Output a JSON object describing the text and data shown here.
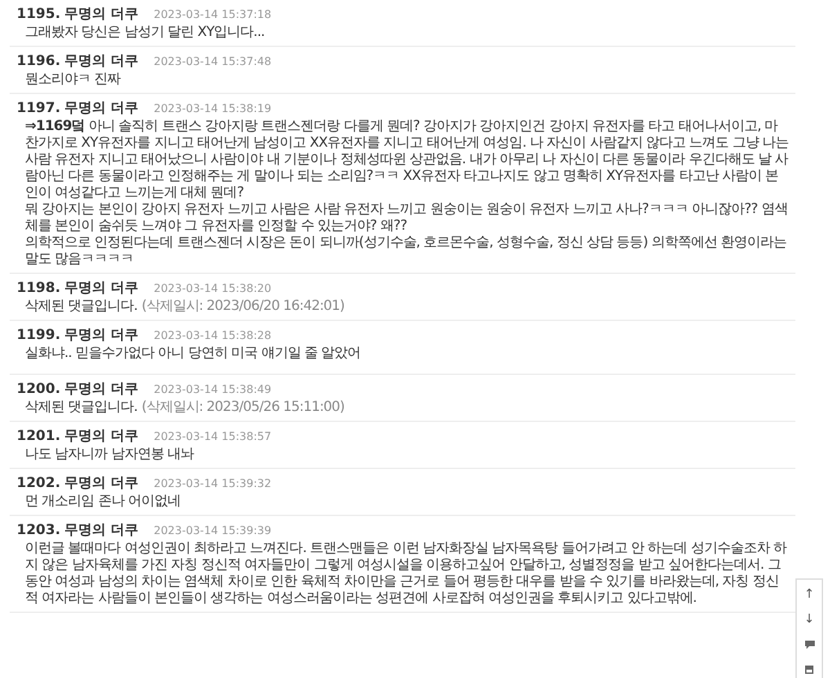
{
  "comments": [
    {
      "number": "1195.",
      "author": "무명의 더쿠",
      "time": "2023-03-14 15:37:18",
      "kind": "text",
      "body": "그래봤자 당신은 남성기 달린 XY입니다..."
    },
    {
      "number": "1196.",
      "author": "무명의 더쿠",
      "time": "2023-03-14 15:37:48",
      "kind": "text",
      "body": "뭔소리야ㅋ 진짜"
    },
    {
      "number": "1197.",
      "author": "무명의 더쿠",
      "time": "2023-03-14 15:38:19",
      "kind": "text",
      "body": "**⇒1169덬** 아니 솔직히 트랜스 강아지랑 트랜스젠더랑 다를게 뭔데? 강아지가 강아지인건 강아지 유전자를 타고 태어나서이고, 마찬가지로 XY유전자를 지니고 태어난게 남성이고 XX유전자를 지니고 태어난게 여성임. 나 자신이 사람같지 않다고 느껴도 그냥 나는 사람 유전자 지니고 태어났으니 사람이야 내 기분이나 정체성따윈 상관없음. 내가 아무리 나 자신이 다른 동물이라 우긴다해도 날 사람아닌 다른 동물이라고 인정해주는 게 말이나 되는 소리임?ㅋㅋ XX유전자 타고나지도 않고 명확히 XY유전자를 타고난 사람이 본인이 여성같다고 느끼는게 대체 뭔데?\n뭐 강아지는 본인이 강아지 유전자 느끼고 사람은 사람 유전자 느끼고 원숭이는 원숭이 유전자 느끼고 사나?ㅋㅋㅋ 아니잖아?? 염색체를 본인이 숨쉬듯 느껴야 그 유전자를 인정할 수 있는거야? 왜??\n의학적으로 인정된다는데 트랜스젠더 시장은 돈이 되니까(성기수술, 호르몬수술, 성형수술, 정신 상담 등등) 의학쪽에선 환영이라는 말도 많음ㅋㅋㅋㅋ"
    },
    {
      "number": "1198.",
      "author": "무명의 더쿠",
      "time": "2023-03-14 15:38:20",
      "kind": "deleted",
      "body": "삭제된 댓글입니다.",
      "deleted_at": "(삭제일시: 2023/06/20 16:42:01)"
    },
    {
      "number": "1199.",
      "author": "무명의 더쿠",
      "time": "2023-03-14 15:38:28",
      "kind": "text",
      "body": "실화냐.. 믿을수가없다 아니 당연히 미국 얘기일 줄 알았어"
    },
    {
      "number": "1200.",
      "author": "무명의 더쿠",
      "time": "2023-03-14 15:38:49",
      "kind": "deleted",
      "body": "삭제된 댓글입니다.",
      "deleted_at": "(삭제일시: 2023/05/26 15:11:00)"
    },
    {
      "number": "1201.",
      "author": "무명의 더쿠",
      "time": "2023-03-14 15:38:57",
      "kind": "text",
      "body": "나도 남자니까 남자연봉 내놔"
    },
    {
      "number": "1202.",
      "author": "무명의 더쿠",
      "time": "2023-03-14 15:39:32",
      "kind": "text",
      "body": "먼 개소리임 존나 어이없네"
    },
    {
      "number": "1203.",
      "author": "무명의 더쿠",
      "time": "2023-03-14 15:39:39",
      "kind": "text",
      "body": "이런글 볼때마다 여성인권이 최하라고 느껴진다. 트랜스맨들은 이런 남자화장실 남자목욕탕 들어가려고 안 하는데 성기수술조차 하지 않은 남자육체를 가진 자칭 정신적 여자들만이 그렇게 여성시설을 이용하고싶어 안달하고, 성별정정을 받고 싶어한다는데서. 그동안 여성과 남성의 차이는 염색체 차이로 인한 육체적 차이만을 근거로 들어 평등한 대우를 받을 수 있기를 바라왔는데, 자칭 정신적 여자라는 사람들이 본인들이 생각하는 여성스러움이라는 성편견에 사로잡혀 여성인권을 후퇴시키고 있다고밖에."
    }
  ],
  "float_buttons": [
    {
      "kind": "text",
      "label": "↑"
    },
    {
      "kind": "text",
      "label": "↓"
    },
    {
      "kind": "chat"
    },
    {
      "kind": "save"
    }
  ]
}
